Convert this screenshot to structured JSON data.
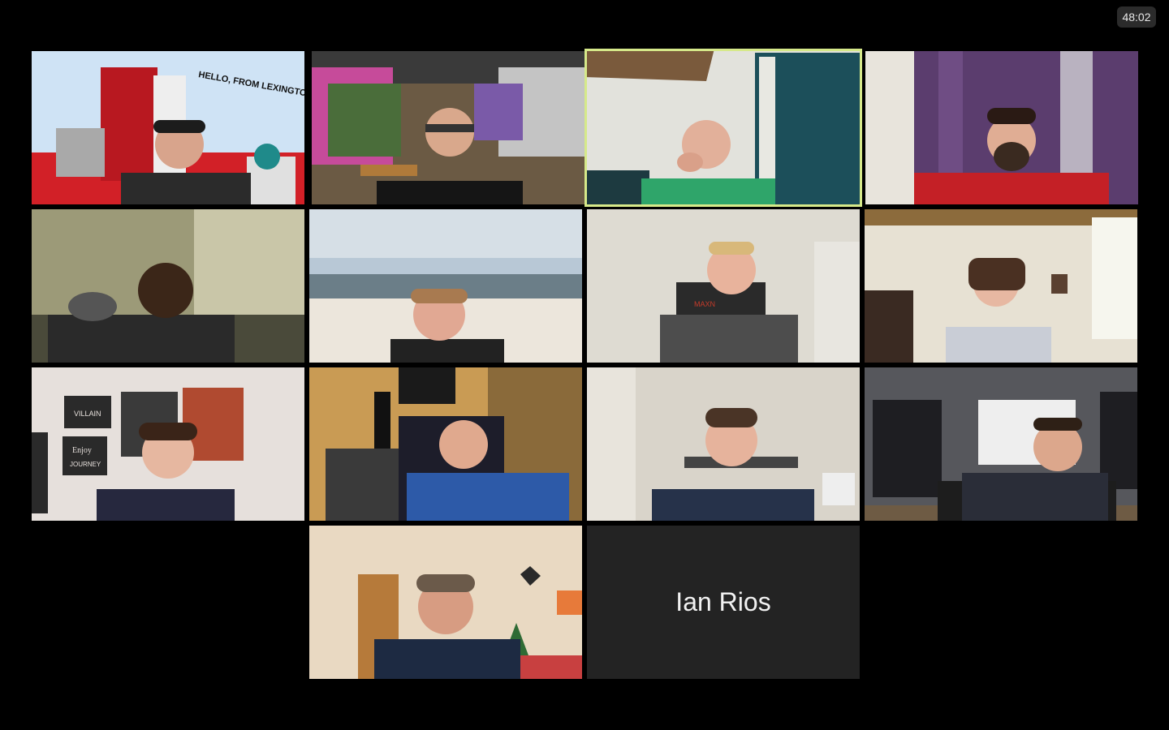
{
  "meeting": {
    "timer": "48:02"
  },
  "tiles": [
    {
      "id": "tile-1",
      "overlay_text": "HELLO, FROM LEXINGTON"
    },
    {
      "id": "tile-2"
    },
    {
      "id": "tile-3",
      "active_speaker": true
    },
    {
      "id": "tile-4"
    },
    {
      "id": "tile-5"
    },
    {
      "id": "tile-6"
    },
    {
      "id": "tile-7",
      "poster_text": "MAXN"
    },
    {
      "id": "tile-8"
    },
    {
      "id": "tile-9",
      "poster_text_1": "VILLAIN",
      "poster_text_2": "Enjoy",
      "poster_text_3": "JOURNEY"
    },
    {
      "id": "tile-10"
    },
    {
      "id": "tile-11"
    },
    {
      "id": "tile-12"
    },
    {
      "id": "tile-13"
    },
    {
      "id": "tile-14",
      "participant_name": "Ian Rios",
      "camera_off": true
    }
  ],
  "colors": {
    "active_speaker_border": "#d6e98a",
    "background": "#000000",
    "name_tile_bg": "#232323"
  }
}
